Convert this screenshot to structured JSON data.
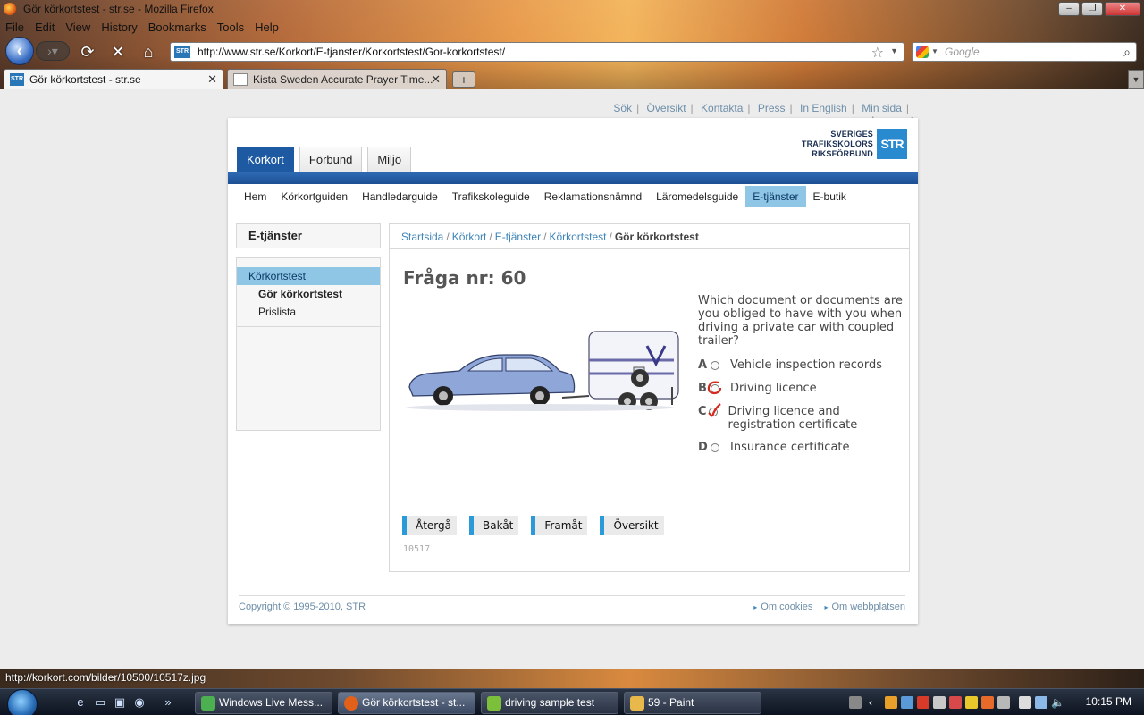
{
  "window": {
    "title": "Gör körkortstest - str.se - Mozilla Firefox",
    "buttons": {
      "minimize": "–",
      "maximize": "❐",
      "close": "✕"
    }
  },
  "menubar": [
    "File",
    "Edit",
    "View",
    "History",
    "Bookmarks",
    "Tools",
    "Help"
  ],
  "navbar": {
    "url": "http://www.str.se/Korkort/E-tjanster/Korkortstest/Gor-korkortstest/",
    "site_badge": "STR",
    "search_placeholder": "Google"
  },
  "tabs": [
    {
      "label": "Gör körkortstest - str.se",
      "favicon": "STR"
    },
    {
      "label": "Kista Sweden Accurate Prayer Time..."
    }
  ],
  "page": {
    "toplinks": [
      "Sök",
      "Översikt",
      "Kontakta",
      "Press",
      "In English",
      "Min sida",
      "Logga ut"
    ],
    "logo": {
      "line1": "SVERIGES",
      "line2": "TRAFIKSKOLORS",
      "line3": "RIKSFÖRBUND",
      "mark": "STR"
    },
    "main_tabs": [
      "Körkort",
      "Förbund",
      "Miljö"
    ],
    "subnav": [
      "Hem",
      "Körkortguiden",
      "Handledarguide",
      "Trafikskoleguide",
      "Reklamationsnämnd",
      "Läromedelsguide",
      "E-tjänster",
      "E-butik"
    ],
    "sidebar": {
      "heading": "E-tjänster",
      "items": [
        "Körkortstest",
        "Gör körkortstest",
        "Prislista"
      ]
    },
    "breadcrumb": [
      "Startsida",
      "Körkort",
      "E-tjänster",
      "Körkortstest",
      "Gör körkortstest"
    ],
    "question": {
      "title": "Fråga nr: 60",
      "text": "Which document or documents are you obliged to have with you when driving a private car with coupled trailer?",
      "answers": [
        {
          "letter": "A",
          "label": "Vehicle inspection records"
        },
        {
          "letter": "B",
          "label": "Driving licence"
        },
        {
          "letter": "C",
          "label": "Driving licence and registration certificate"
        },
        {
          "letter": "D",
          "label": "Insurance certificate"
        }
      ],
      "id": "10517"
    },
    "buttons": [
      "Återgå",
      "Bakåt",
      "Framåt",
      "Översikt"
    ],
    "footer": {
      "copyright": "Copyright © 1995-2010, STR",
      "links": [
        "Om cookies",
        "Om webbplatsen"
      ]
    }
  },
  "statusbar": {
    "text": "http://korkort.com/bilder/10500/10517z.jpg"
  },
  "taskbar": {
    "items": [
      "Windows Live Mess...",
      "Gör körkortstest - st...",
      "driving sample test",
      "59 - Paint"
    ],
    "clock": "10:15 PM"
  },
  "colors": {
    "site_blue": "#1d5aa1",
    "accent_light": "#8fc6e6",
    "link": "#3d84b8",
    "button_accent": "#2a9ad8"
  }
}
